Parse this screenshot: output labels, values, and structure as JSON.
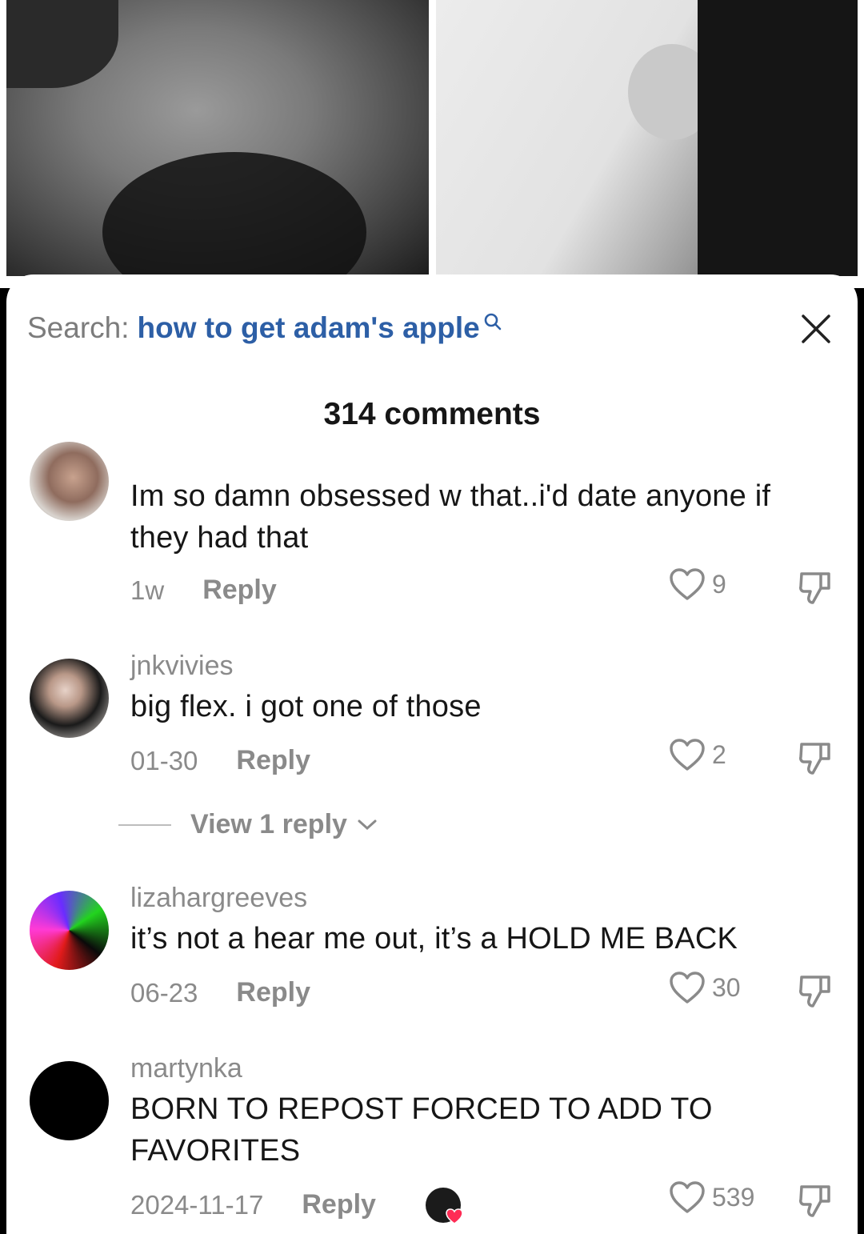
{
  "search": {
    "label": "Search:",
    "query": "how to get adam's apple"
  },
  "comments_title": "314 comments",
  "comments": [
    {
      "username": "",
      "text": "Im so damn obsessed w that..i'd date anyone if they had that",
      "date": "1w",
      "reply_label": "Reply",
      "likes": "9"
    },
    {
      "username": "jnkvivies",
      "text": "big flex. i got one of those",
      "date": "01-30",
      "reply_label": "Reply",
      "likes": "2"
    },
    {
      "username": "lizahargreeves",
      "text": "it’s not a hear me out, it’s a HOLD ME BACK",
      "date": "06-23",
      "reply_label": "Reply",
      "likes": "30"
    },
    {
      "username": "martynka",
      "text": "BORN TO REPOST FORCED TO ADD TO FAVORITES",
      "date": "2024-11-17",
      "reply_label": "Reply",
      "likes": "539"
    }
  ],
  "view_replies": "View 1 reply",
  "colors": {
    "link_blue": "#2d5fa6",
    "muted": "#8a8a8a",
    "text": "#161616",
    "heart_red": "#fe2c55"
  }
}
